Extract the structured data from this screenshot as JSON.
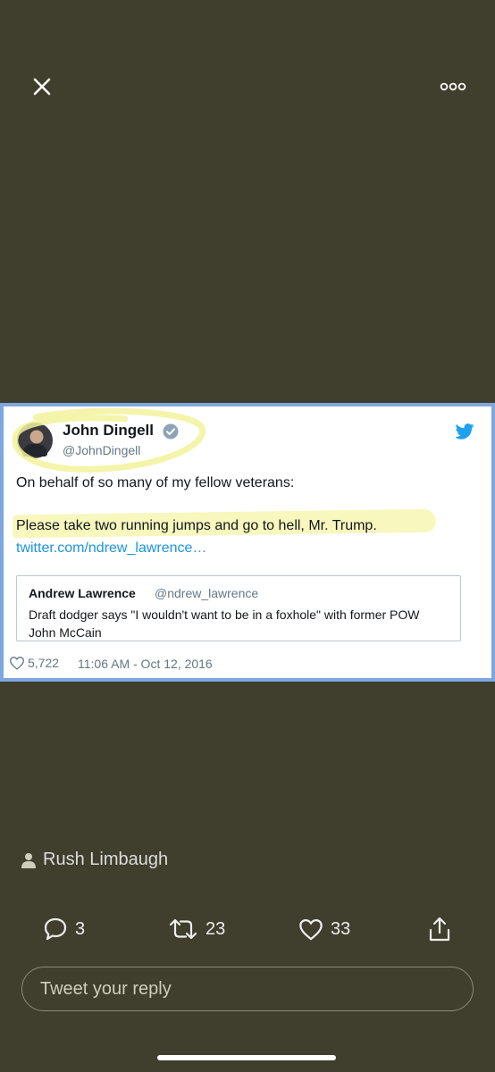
{
  "header": {
    "close_icon": "close-icon",
    "more_icon": "more-options-icon"
  },
  "embedded_tweet": {
    "author_name": "John Dingell",
    "author_handle": "@JohnDingell",
    "line1": "On behalf of so many of my fellow veterans:",
    "line2": "Please take two running jumps and go to hell, Mr. Trump.",
    "link": "twitter.com/ndrew_lawrence…",
    "quote": {
      "name": "Andrew Lawrence",
      "handle": "@ndrew_lawrence",
      "text": "Draft dodger says \"I wouldn't want to be in a foxhole\" with former POW John McCain"
    },
    "likes": "5,722",
    "timestamp": "11:06 AM - Oct 12, 2016",
    "colors": {
      "highlight": "#f2f39b",
      "frame": "#7ea7df",
      "link": "#1b95e0"
    }
  },
  "poster": {
    "name": "Rush Limbaugh"
  },
  "actions": {
    "replies": "3",
    "retweets": "23",
    "likes": "33",
    "share_icon": "share-icon"
  },
  "reply": {
    "placeholder": "Tweet your reply"
  },
  "colors": {
    "background": "#403e2c"
  }
}
